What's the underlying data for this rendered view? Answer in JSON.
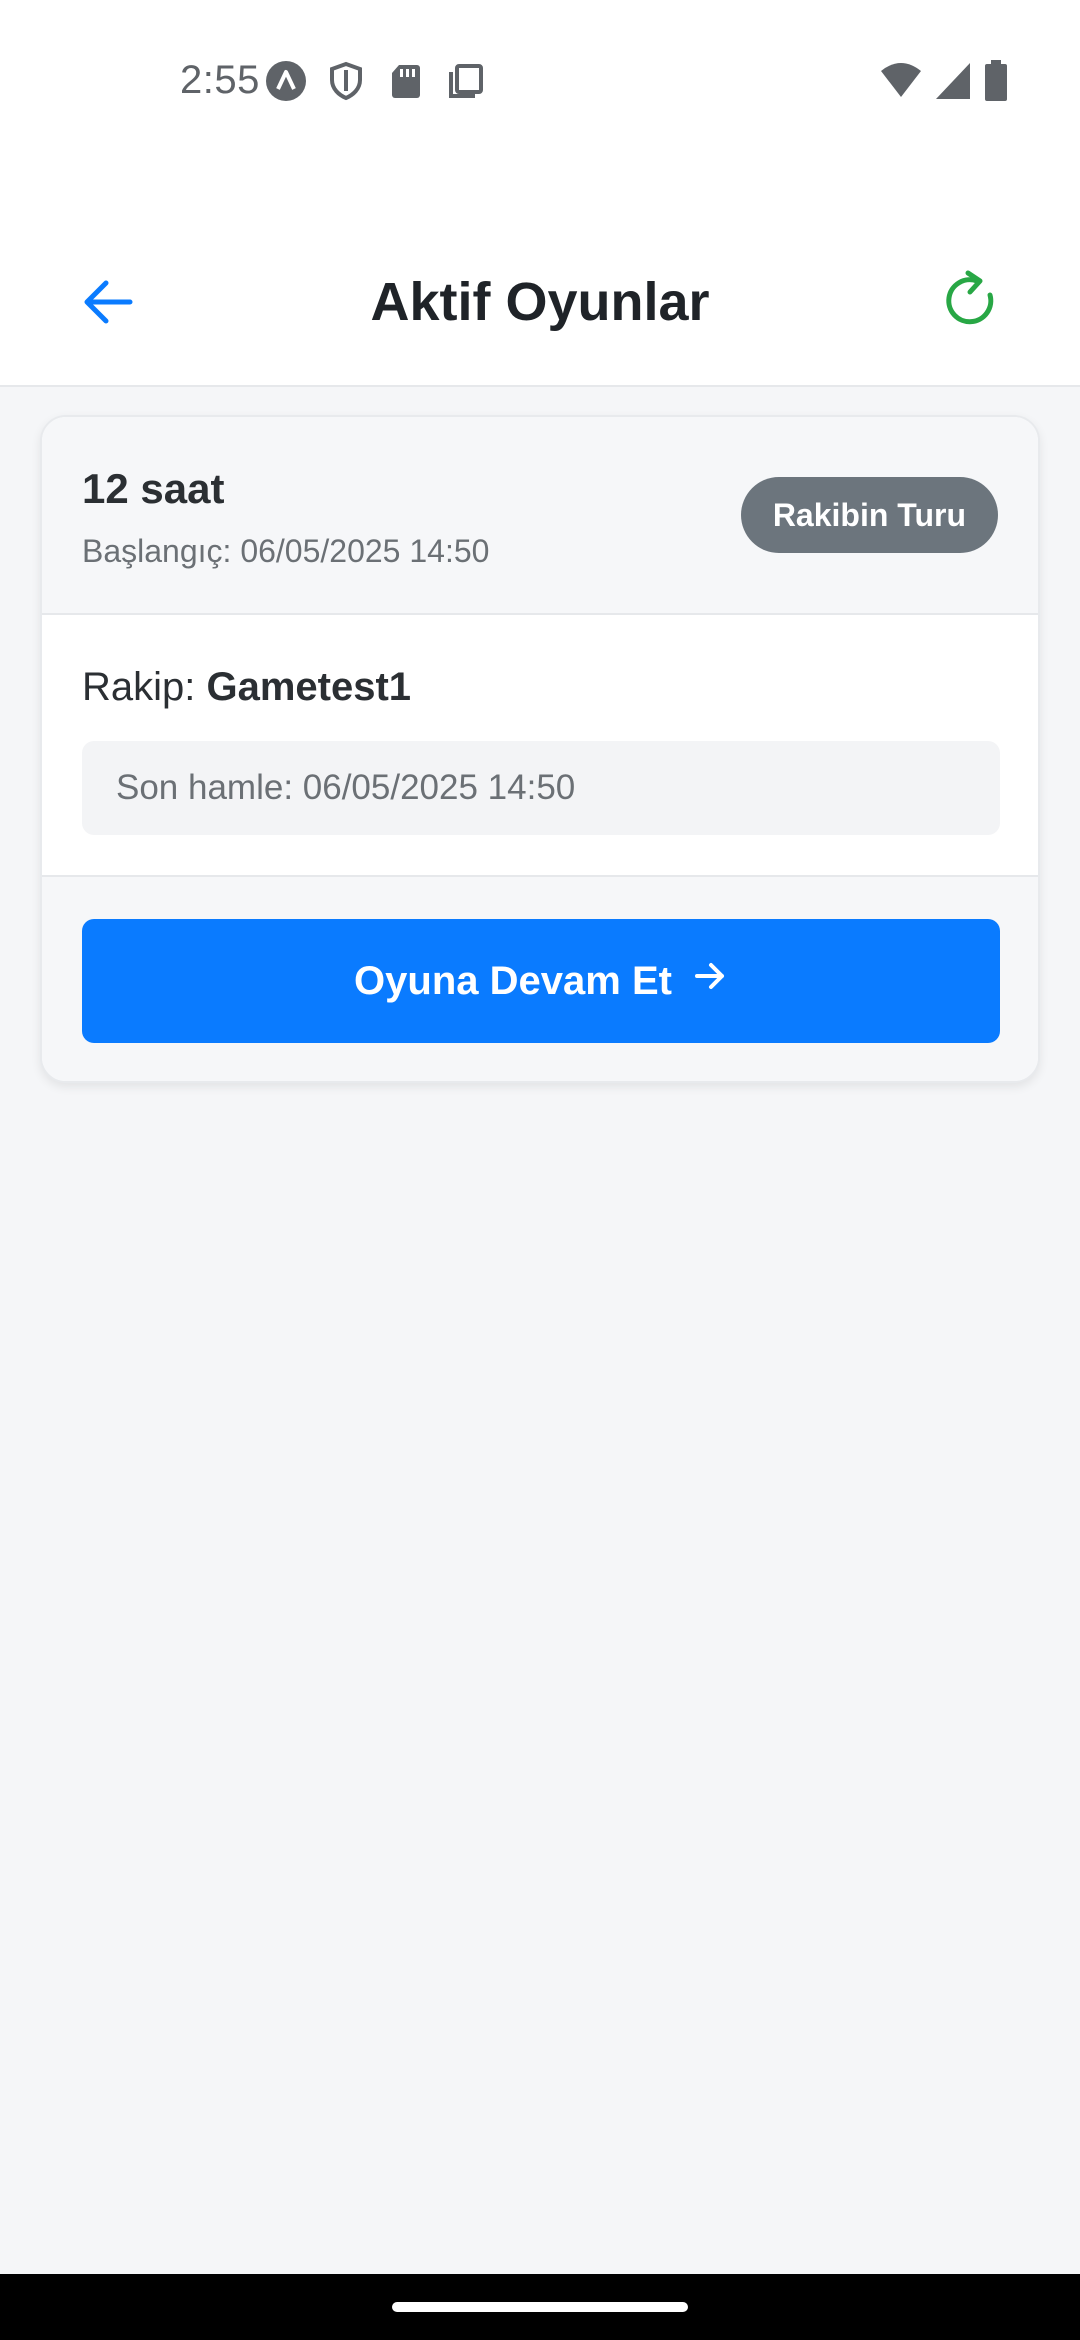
{
  "status_bar": {
    "time": "2:55",
    "left_icons": [
      "app-notification-icon",
      "shield-icon",
      "sd-card-icon",
      "copy-icon"
    ],
    "right_icons": [
      "wifi-icon",
      "cell-signal-icon",
      "battery-icon"
    ]
  },
  "header": {
    "title": "Aktif Oyunlar",
    "back_icon": "arrow-left-icon",
    "refresh_icon": "refresh-icon",
    "accent_color": "#0a7bff",
    "refresh_color": "#28a745"
  },
  "game_card": {
    "time_limit": "12 saat",
    "start_label": "Başlangıç: 06/05/2025 14:50",
    "turn_badge": "Rakibin Turu",
    "opponent_prefix": "Rakip: ",
    "opponent_name": "Gametest1",
    "last_move": "Son hamle: 06/05/2025 14:50",
    "continue_label": "Oyuna Devam Et",
    "badge_color": "#6c757d",
    "button_color": "#0a7bff"
  }
}
